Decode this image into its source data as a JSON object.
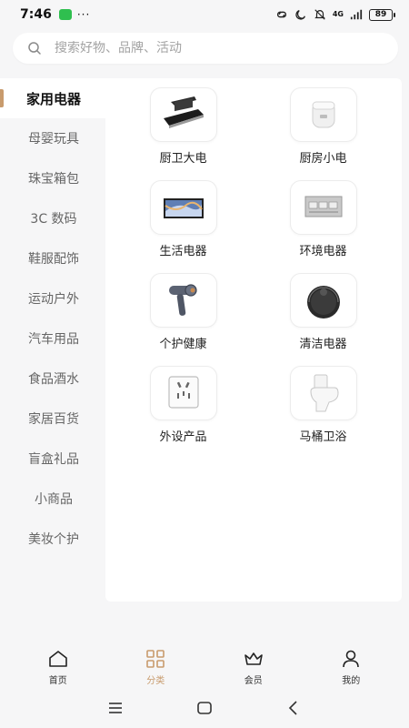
{
  "status_bar": {
    "time": "7:46",
    "dots": "···",
    "network": "4G",
    "battery": "89"
  },
  "search": {
    "placeholder": "搜索好物、品牌、活动"
  },
  "sidebar": {
    "items": [
      {
        "label": "家用电器",
        "active": true
      },
      {
        "label": "母婴玩具",
        "active": false
      },
      {
        "label": "珠宝箱包",
        "active": false
      },
      {
        "label": "3C 数码",
        "active": false
      },
      {
        "label": "鞋服配饰",
        "active": false
      },
      {
        "label": "运动户外",
        "active": false
      },
      {
        "label": "汽车用品",
        "active": false
      },
      {
        "label": "食品酒水",
        "active": false
      },
      {
        "label": "家居百货",
        "active": false
      },
      {
        "label": "盲盒礼品",
        "active": false
      },
      {
        "label": "小商品",
        "active": false
      },
      {
        "label": "美妆个护",
        "active": false
      }
    ]
  },
  "categories": [
    {
      "label": "厨卫大电",
      "icon": "range-hood-icon"
    },
    {
      "label": "厨房小电",
      "icon": "rice-cooker-icon"
    },
    {
      "label": "生活电器",
      "icon": "tv-icon"
    },
    {
      "label": "环境电器",
      "icon": "air-conditioner-icon"
    },
    {
      "label": "个护健康",
      "icon": "hair-dryer-icon"
    },
    {
      "label": "清洁电器",
      "icon": "robot-vacuum-icon"
    },
    {
      "label": "外设产品",
      "icon": "wall-socket-icon"
    },
    {
      "label": "马桶卫浴",
      "icon": "toilet-icon"
    }
  ],
  "tabbar": {
    "items": [
      {
        "label": "首页",
        "icon": "home-icon",
        "active": false
      },
      {
        "label": "分类",
        "icon": "category-grid-icon",
        "active": true
      },
      {
        "label": "会员",
        "icon": "crown-icon",
        "active": false
      },
      {
        "label": "我的",
        "icon": "user-icon",
        "active": false
      }
    ]
  },
  "colors": {
    "accent": "#c89b6d",
    "background": "#f6f6f7"
  }
}
